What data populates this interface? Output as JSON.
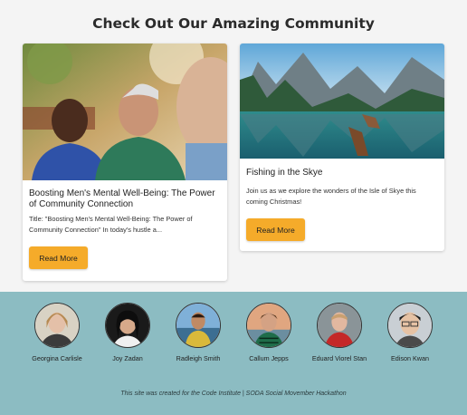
{
  "page": {
    "title": "Check Out Our Amazing Community"
  },
  "cards": [
    {
      "title": "Boosting Men's Mental Well-Being: The Power of Community Connection",
      "excerpt": "Title: \"Boosting Men's Mental Well-Being: The Power of Community Connection\" In today's hustle a...",
      "button": "Read More"
    },
    {
      "title": "Fishing in the Skye",
      "excerpt": "Join us as we explore the wonders of the Isle of Skye this coming Christmas!",
      "button": "Read More"
    }
  ],
  "team": [
    {
      "name": "Georgina Carlisle"
    },
    {
      "name": "Joy Zadan"
    },
    {
      "name": "Radleigh Smith"
    },
    {
      "name": "Callum Jepps"
    },
    {
      "name": "Eduard Viorel Stan"
    },
    {
      "name": "Edison Kwan"
    }
  ],
  "footer": {
    "text": "This site was created for the Code Institute | SODA Social Movember Hackathon"
  },
  "colors": {
    "accent": "#f5ab2a",
    "team_bg": "#8cbcc2",
    "page_bg": "#f4f4f4"
  }
}
